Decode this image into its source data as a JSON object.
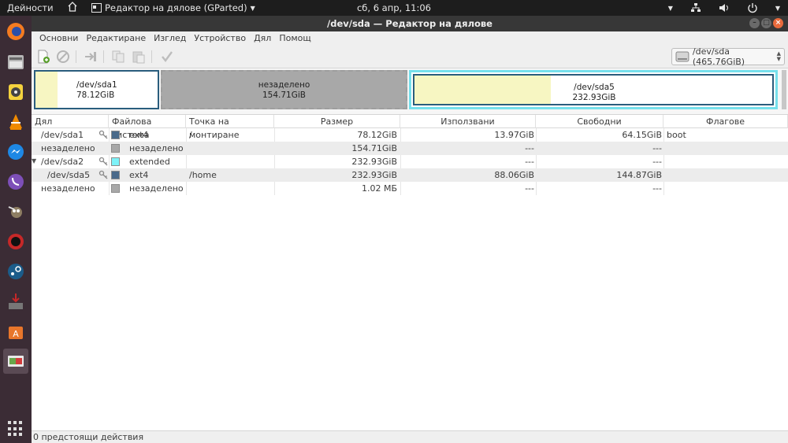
{
  "topbar": {
    "activities": "Дейности",
    "app_name": "Редактор на дялове (GParted)",
    "clock": "сб,  6 апр, 11:06"
  },
  "window": {
    "title": "/dev/sda — Редактор на дялове"
  },
  "menu": [
    "Основни",
    "Редактиране",
    "Изглед",
    "Устройство",
    "Дял",
    "Помощ"
  ],
  "device_selector": {
    "label": "/dev/sda  (465.76GiB)"
  },
  "diskmap": {
    "sda1": {
      "name": "/dev/sda1",
      "size": "78.12GiB"
    },
    "unalloc": {
      "name": "незаделено",
      "size": "154.71GiB"
    },
    "sda5": {
      "name": "/dev/sda5",
      "size": "232.93GiB"
    }
  },
  "table": {
    "headers": [
      "Дял",
      "Файлова система",
      "Точка на монтиране",
      "Размер",
      "Използвани",
      "Свободни",
      "Флагове"
    ],
    "rows": [
      {
        "partition": "/dev/sda1",
        "fs": "ext4",
        "mount": "/",
        "size": "78.12GiB",
        "used": "13.97GiB",
        "free": "64.15GiB",
        "flags": "boot",
        "color": "#4a6a8a"
      },
      {
        "partition": "незаделено",
        "fs": "незаделено",
        "mount": "",
        "size": "154.71GiB",
        "used": "---",
        "free": "---",
        "flags": "",
        "color": "#a8a8a8"
      },
      {
        "partition": "/dev/sda2",
        "fs": "extended",
        "mount": "",
        "size": "232.93GiB",
        "used": "---",
        "free": "---",
        "flags": "",
        "color": "#7df2f8"
      },
      {
        "partition": "/dev/sda5",
        "fs": "ext4",
        "mount": "/home",
        "size": "232.93GiB",
        "used": "88.06GiB",
        "free": "144.87GiB",
        "flags": "",
        "color": "#4a6a8a"
      },
      {
        "partition": "незаделено",
        "fs": "незаделено",
        "mount": "",
        "size": "1.02 МБ",
        "used": "---",
        "free": "---",
        "flags": "",
        "color": "#a8a8a8"
      }
    ]
  },
  "status": {
    "text": "0 предстоящи действия"
  },
  "colors": {
    "ext4": "#4a6a8a",
    "unallocated": "#a8a8a8",
    "extended": "#7df2f8",
    "used": "#f7f6c2",
    "topbar": "#1d1d1d",
    "launcher": "#3b2c35"
  }
}
